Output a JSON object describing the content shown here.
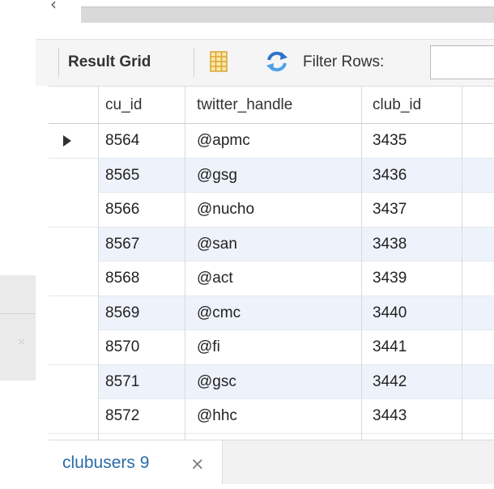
{
  "toolbar": {
    "result_grid_label": "Result Grid",
    "filter_label": "Filter Rows:",
    "filter_value": ""
  },
  "grid": {
    "columns": [
      "cu_id",
      "twitter_handle",
      "club_id"
    ],
    "rows": [
      [
        "8564",
        "@apmc",
        "3435"
      ],
      [
        "8565",
        "@gsg",
        "3436"
      ],
      [
        "8566",
        "@nucho",
        "3437"
      ],
      [
        "8567",
        "@san",
        "3438"
      ],
      [
        "8568",
        "@act",
        "3439"
      ],
      [
        "8569",
        "@cmc",
        "3440"
      ],
      [
        "8570",
        "@fi",
        "3441"
      ],
      [
        "8571",
        "@gsc",
        "3442"
      ],
      [
        "8572",
        "@hhc",
        "3443"
      ]
    ],
    "selected_row": 0
  },
  "tabs": [
    {
      "label": "clubusers 9",
      "close_icon": "close-icon"
    }
  ],
  "colors": {
    "alt_row": "#eef3fb",
    "tab_text": "#2a6ca8",
    "grid_icon": "#e8b84a",
    "refresh_icon": "#2e73c9"
  }
}
